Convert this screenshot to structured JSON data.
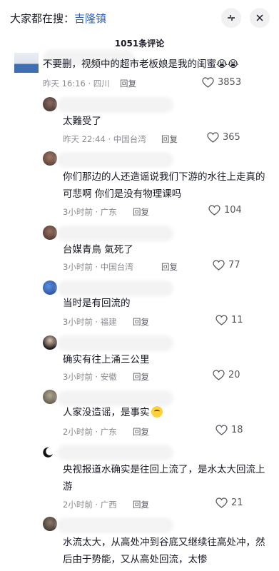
{
  "search": {
    "prefix": "大家都在搜：",
    "term": "吉隆镇"
  },
  "header": {
    "count_label": "1051条评论"
  },
  "comments": [
    {
      "text": "不要删，视频中的超市老板娘是我的闺蜜😭😭",
      "meta": "昨天 16:16 · 四川",
      "reply": "回复",
      "likes": "3853"
    },
    {
      "text": "太難受了",
      "meta": "昨天 22:44 · 中国台湾",
      "reply": "回复",
      "likes": "365"
    },
    {
      "text": "你们那边的人还造谣说我们下游的水往上走真的可悲啊 你们是没有物理课吗",
      "meta": "3小时前 · 广东",
      "reply": "回复",
      "likes": "104"
    },
    {
      "text": "台媒青鳥 氣死了",
      "meta": "3小时前 · 中国台湾",
      "reply": "回复",
      "likes": "77"
    },
    {
      "text": "当时是有回流的",
      "meta": "3小时前 · 福建",
      "reply": "回复",
      "likes": "11"
    },
    {
      "text": "确实有往上涌三公里",
      "meta": "3小时前 · 安徽",
      "reply": "回复",
      "likes": "20"
    },
    {
      "text": "人家没造谣，是事实",
      "meta": "2小时前 · 广东",
      "reply": "回复",
      "likes": "18"
    },
    {
      "text": "央视报道水确实是往回上流了，是水太大回流上游",
      "meta": "2小时前 · 广西",
      "reply": "回复",
      "likes": "21"
    },
    {
      "text": "水流太大，从高处冲到谷底又继续往高处冲，然后由于势能，又从高处回流，太惨",
      "meta": "",
      "reply": "",
      "likes": ""
    }
  ],
  "icons": {
    "collapse": "collapse-arrows-icon",
    "close": "close-icon",
    "like": "heart-outline-icon",
    "emoji": "laughing-emoji-icon"
  }
}
